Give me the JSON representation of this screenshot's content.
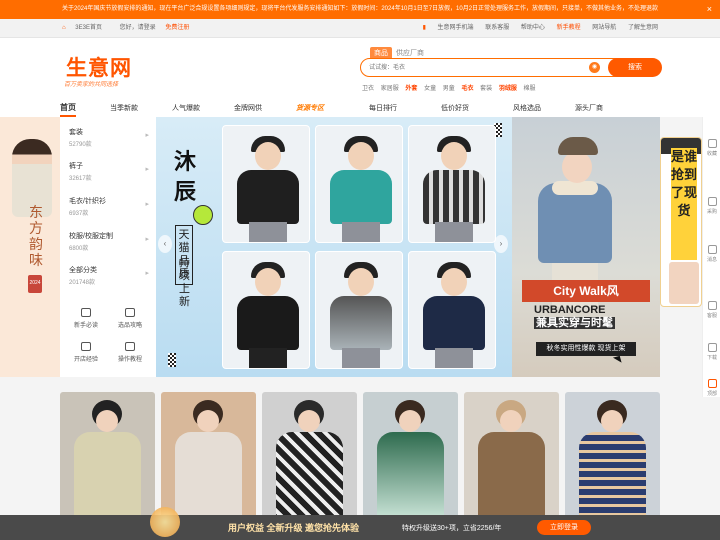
{
  "notice": {
    "text": "关于2024年国庆节放假安排的通知，现在平台广泛合规设置各项细则规定，现将平台代发服务安排通知如下：放假时间：2024年10月1日至7日放假，10月2日正常处理服务工作，放假期间，只接单，不做其他业务，不处理退款",
    "close": "×"
  },
  "topbar": {
    "home": "3E3E首页",
    "greeting": "您好，请登录",
    "register": "免费注册",
    "mobile": "生意网手机端",
    "service": "联系客服",
    "help": "帮助中心",
    "newbie": "新手教程",
    "sitenav": "网站导航",
    "about": "了解生意网"
  },
  "header": {
    "logo": "生意网",
    "slogan": "百万卖家的共同选择",
    "search_tabs": [
      "商品",
      "供应厂商"
    ],
    "search_placeholder": "试试搜：毛衣",
    "search_button": "搜索",
    "camera_icon": "camera-icon",
    "hot_words": [
      "卫衣",
      "家居服",
      "外套",
      "女童",
      "男童",
      "毛衣",
      "套装",
      "羽绒服",
      "棉服"
    ],
    "hot_red": [
      "外套",
      "毛衣",
      "羽绒服"
    ]
  },
  "nav": {
    "items": [
      "首页",
      "当季新款",
      "人气爆款",
      "金牌网供",
      "货源专区",
      "每日排行",
      "低价好货",
      "风格选品",
      "源头厂商"
    ],
    "badges": [
      "",
      "",
      "",
      "",
      "",
      "",
      "",
      "",
      ""
    ]
  },
  "left_ad": {
    "text": "东方韵味",
    "year": "2024"
  },
  "categories": [
    {
      "name": "套装",
      "count": "52790款"
    },
    {
      "name": "裤子",
      "count": "32617款"
    },
    {
      "name": "毛衣/针织衫",
      "count": "6937款"
    },
    {
      "name": "校服/校服定制",
      "count": "6800款"
    },
    {
      "name": "全部分类",
      "count": "201748款"
    }
  ],
  "tools": [
    "新手必读",
    "选品攻略",
    "开店经验",
    "操作教程"
  ],
  "banner": {
    "title": "沐辰",
    "sub": "天猫品质",
    "sub2": "持续上新",
    "colors": {
      "bg": "#cfe6f5"
    }
  },
  "right_ad": {
    "title": "City Walk风",
    "brand": "URBANCORE",
    "brand_sub": "兼具实穿与时髦",
    "tag": "秋冬实用性爆款 现货上架"
  },
  "float_ad": {
    "text": "是谁抢到了现货"
  },
  "rail": [
    "收藏",
    "采购",
    "消息",
    "客服",
    "下载",
    "顶部"
  ],
  "bottom": {
    "title": "用户权益 全新升级 邀您抢先体验",
    "desc": "特权升级送30+项，立省2256/年",
    "button": "立即登录"
  },
  "colors": {
    "brand": "#ff5500",
    "accent": "#ff6d00"
  }
}
